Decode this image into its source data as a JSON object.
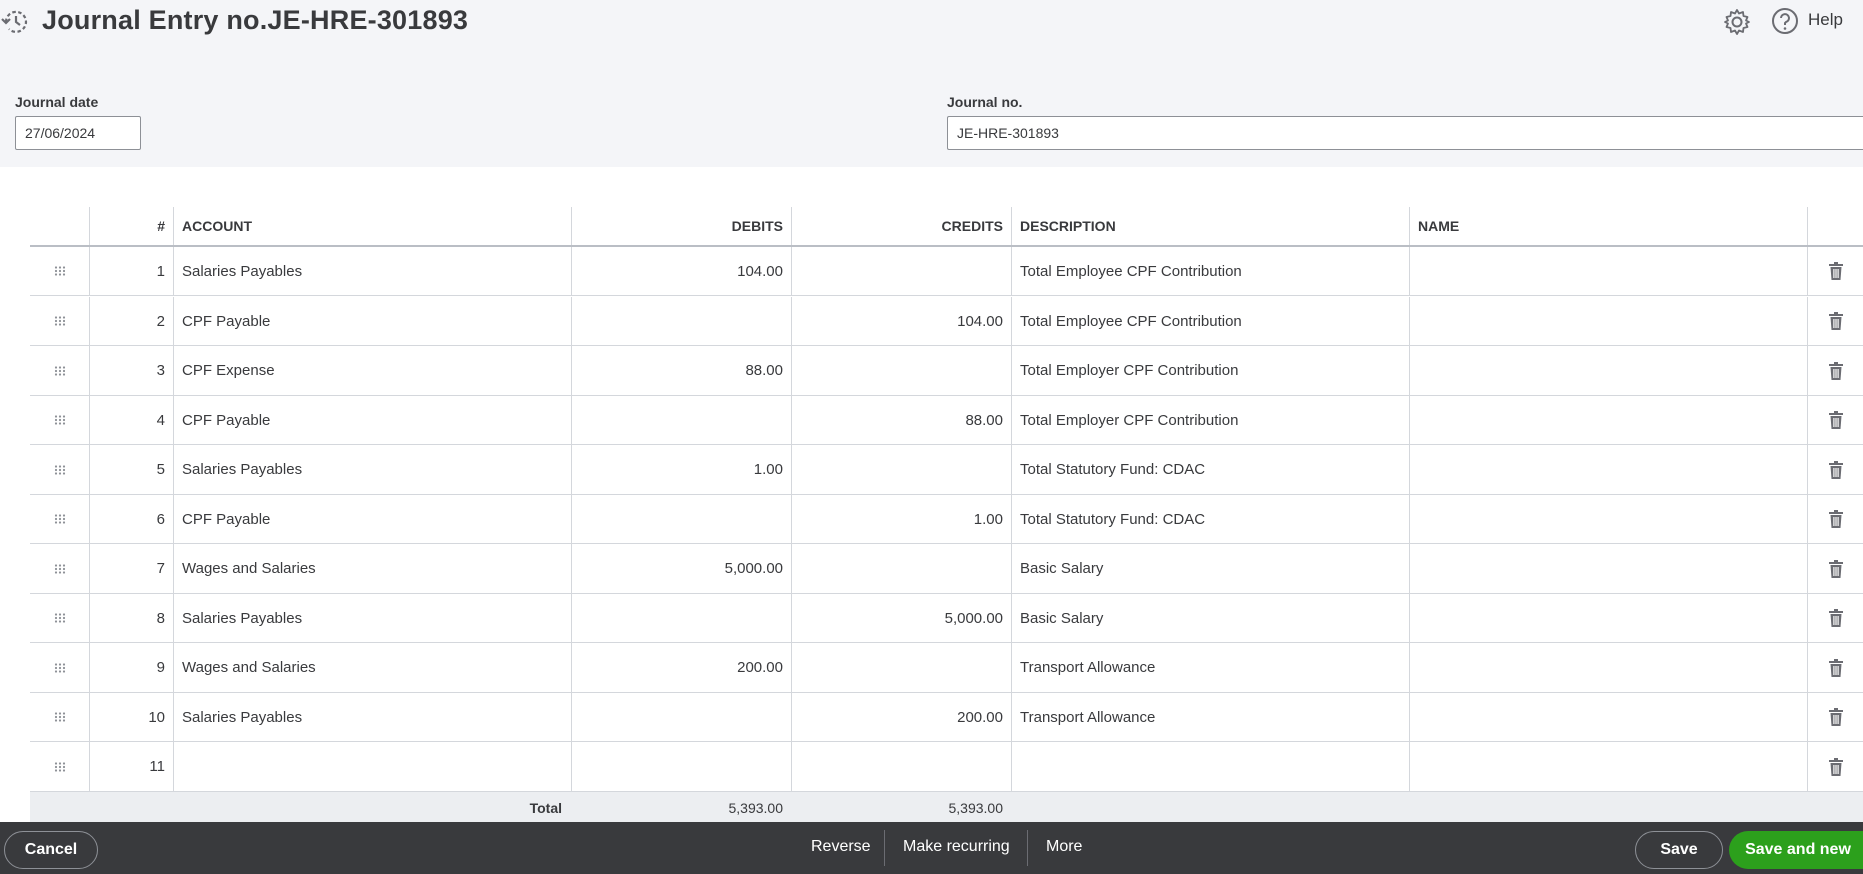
{
  "header": {
    "title": "Journal Entry no.JE-HRE-301893",
    "help_label": "Help"
  },
  "form": {
    "journal_date_label": "Journal date",
    "journal_date_value": "27/06/2024",
    "journal_no_label": "Journal no.",
    "journal_no_value": "JE-HRE-301893"
  },
  "table": {
    "columns": {
      "num": "#",
      "account": "ACCOUNT",
      "debits": "DEBITS",
      "credits": "CREDITS",
      "description": "DESCRIPTION",
      "name": "NAME"
    },
    "rows": [
      {
        "num": "1",
        "account": "Salaries Payables",
        "debit": "104.00",
        "credit": "",
        "description": "Total Employee CPF Contribution",
        "name": ""
      },
      {
        "num": "2",
        "account": "CPF Payable",
        "debit": "",
        "credit": "104.00",
        "description": "Total Employee CPF Contribution",
        "name": ""
      },
      {
        "num": "3",
        "account": "CPF Expense",
        "debit": "88.00",
        "credit": "",
        "description": "Total Employer CPF Contribution",
        "name": ""
      },
      {
        "num": "4",
        "account": "CPF Payable",
        "debit": "",
        "credit": "88.00",
        "description": "Total Employer CPF Contribution",
        "name": ""
      },
      {
        "num": "5",
        "account": "Salaries Payables",
        "debit": "1.00",
        "credit": "",
        "description": "Total Statutory Fund: CDAC",
        "name": ""
      },
      {
        "num": "6",
        "account": "CPF Payable",
        "debit": "",
        "credit": "1.00",
        "description": "Total Statutory Fund: CDAC",
        "name": ""
      },
      {
        "num": "7",
        "account": "Wages and Salaries",
        "debit": "5,000.00",
        "credit": "",
        "description": "Basic Salary",
        "name": ""
      },
      {
        "num": "8",
        "account": "Salaries Payables",
        "debit": "",
        "credit": "5,000.00",
        "description": "Basic Salary",
        "name": ""
      },
      {
        "num": "9",
        "account": "Wages and Salaries",
        "debit": "200.00",
        "credit": "",
        "description": "Transport Allowance",
        "name": ""
      },
      {
        "num": "10",
        "account": "Salaries Payables",
        "debit": "",
        "credit": "200.00",
        "description": "Transport Allowance",
        "name": ""
      },
      {
        "num": "11",
        "account": "",
        "debit": "",
        "credit": "",
        "description": "",
        "name": ""
      }
    ],
    "total": {
      "label": "Total",
      "debits": "5,393.00",
      "credits": "5,393.00"
    }
  },
  "footer": {
    "cancel_label": "Cancel",
    "reverse_label": "Reverse",
    "make_recurring_label": "Make recurring",
    "more_label": "More",
    "save_label": "Save",
    "save_new_label": "Save and new"
  },
  "colors": {
    "header_bg": "#f4f5f8",
    "footer_bg": "#393a3d",
    "primary_green": "#2ca01c",
    "border": "#d4d7dc"
  },
  "icons": {
    "history": "history-icon",
    "settings": "gear-icon",
    "help": "help-icon",
    "drag": "drag-handle-icon",
    "delete": "trash-icon"
  }
}
